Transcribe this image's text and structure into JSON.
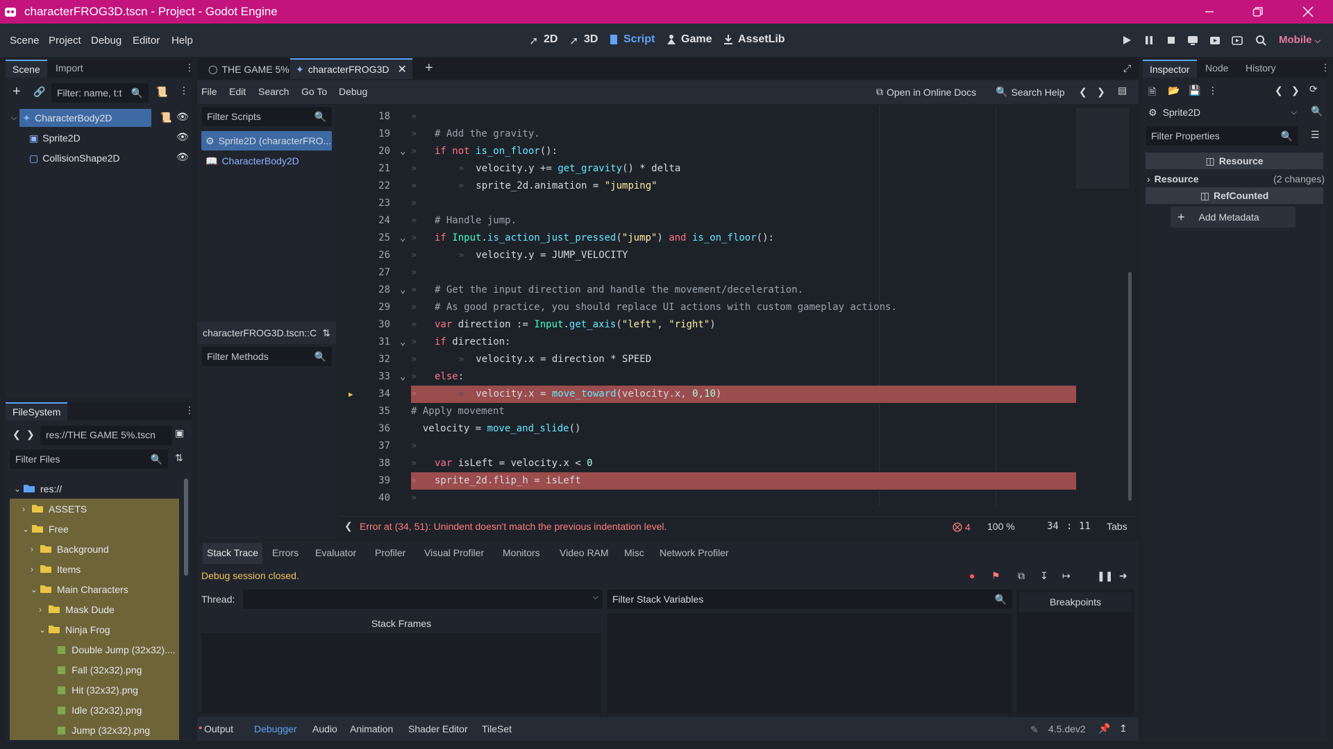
{
  "window": {
    "title": "characterFROG3D.tscn - Project - Godot Engine",
    "brand_color": "#c3147d"
  },
  "menu": [
    "Scene",
    "Project",
    "Debug",
    "Editor",
    "Help"
  ],
  "main_screens": [
    {
      "label": "2D",
      "icon": "2d-icon"
    },
    {
      "label": "3D",
      "icon": "3d-icon"
    },
    {
      "label": "Script",
      "icon": "script-icon",
      "active": true
    },
    {
      "label": "Game",
      "icon": "game-icon"
    },
    {
      "label": "AssetLib",
      "icon": "assetlib-icon"
    }
  ],
  "renderer": "Mobile",
  "scene_dock": {
    "tabs": [
      "Scene",
      "Import"
    ],
    "filter_placeholder": "Filter: name, t:t",
    "nodes": [
      {
        "label": "CharacterBody2D",
        "selected": true
      },
      {
        "label": "Sprite2D"
      },
      {
        "label": "CollisionShape2D"
      }
    ]
  },
  "filesystem": {
    "tab": "FileSystem",
    "path": "res://THE GAME 5%.tscn",
    "filter_placeholder": "Filter Files",
    "items": [
      {
        "label": "res://",
        "kind": "folder-open"
      },
      {
        "label": "ASSETS",
        "kind": "folder"
      },
      {
        "label": "Free",
        "kind": "folder-open"
      },
      {
        "label": "Background",
        "kind": "folder"
      },
      {
        "label": "Items",
        "kind": "folder"
      },
      {
        "label": "Main Characters",
        "kind": "folder-open"
      },
      {
        "label": "Mask Dude",
        "kind": "folder"
      },
      {
        "label": "Ninja Frog",
        "kind": "folder-open"
      },
      {
        "label": "Double Jump (32x32)....",
        "kind": "image"
      },
      {
        "label": "Fall (32x32).png",
        "kind": "image"
      },
      {
        "label": "Hit (32x32).png",
        "kind": "image"
      },
      {
        "label": "Idle (32x32).png",
        "kind": "image"
      },
      {
        "label": "Jump (32x32).png",
        "kind": "image"
      }
    ]
  },
  "scene_tabs": [
    "THE GAME 5%",
    "characterFROG3D"
  ],
  "script_menu": [
    "File",
    "Edit",
    "Search",
    "Go To",
    "Debug"
  ],
  "script_toolbar": {
    "docs": "Open in Online Docs",
    "help": "Search Help"
  },
  "script_list": {
    "filter_placeholder": "Filter Scripts",
    "items": [
      "Sprite2D (characterFRO...",
      "CharacterBody2D"
    ],
    "current": "characterFROG3D.tscn::C",
    "methods_placeholder": "Filter Methods"
  },
  "code": {
    "lines": [
      {
        "n": "18",
        "html": ""
      },
      {
        "n": "19",
        "html": "<span class='com'># Add the gravity.</span>"
      },
      {
        "n": "20",
        "html": "<span class='kw'>if not</span> <span class='fn'>is_on_floor</span>():"
      },
      {
        "n": "21",
        "html": "\t<span class='tabmark'>»</span> velocity.y += <span class='fn'>get_gravity</span>() * delta"
      },
      {
        "n": "22",
        "html": "\t<span class='tabmark'>»</span> sprite_2d.animation = <span class='str'>\"jumping\"</span>"
      },
      {
        "n": "23",
        "html": ""
      },
      {
        "n": "24",
        "html": "<span class='com'># Handle jump.</span>"
      },
      {
        "n": "25",
        "html": "<span class='kw'>if</span> <span class='cls'>Input</span>.<span class='fn'>is_action_just_pressed</span>(<span class='str'>\"jump\"</span>) <span class='kw'>and</span> <span class='fn'>is_on_floor</span>():"
      },
      {
        "n": "26",
        "html": "\t<span class='tabmark'>»</span> velocity.y = JUMP_VELOCITY"
      },
      {
        "n": "27",
        "html": ""
      },
      {
        "n": "28",
        "html": "<span class='com'># Get the input direction and handle the movement/deceleration.</span>"
      },
      {
        "n": "29",
        "html": "<span class='com'># As good practice, you should replace UI actions with custom gameplay actions.</span>"
      },
      {
        "n": "30",
        "html": "<span class='kw'>var</span> direction := <span class='cls'>Input</span>.<span class='fn'>get_axis</span>(<span class='str'>\"left\"</span>, <span class='str'>\"right\"</span>)"
      },
      {
        "n": "31",
        "html": "<span class='kw'>if</span> direction:"
      },
      {
        "n": "32",
        "html": "\t<span class='tabmark'>»</span> velocity.x = direction * SPEED"
      },
      {
        "n": "33",
        "html": "<span class='kw'>else</span>:"
      },
      {
        "n": "34",
        "html": "\t<span class='tabmark'>»</span> velocity.x = <span class='fn'>move_toward</span>(velocity.x, <span class='num'>0</span>,<span class='num'>10</span>)",
        "error": true,
        "exec": true
      },
      {
        "n": "35",
        "html": "<span class='com'># Apply movement</span>",
        "outdent": true
      },
      {
        "n": "36",
        "html": "  velocity = <span class='fn'>move_and_slide</span>()",
        "outdent": true
      },
      {
        "n": "37",
        "html": ""
      },
      {
        "n": "38",
        "html": "<span class='kw'>var</span> isLeft = velocity.x &lt; <span class='num'>0</span>"
      },
      {
        "n": "39",
        "html": "sprite_2d.flip_h = isLeft",
        "error": true
      },
      {
        "n": "40",
        "html": ""
      }
    ]
  },
  "status": {
    "error": "Error at (34, 51): Unindent doesn't match the previous indentation level.",
    "error_count": "4",
    "zoom": "100 %",
    "line": "34",
    "sep": ":",
    "col": "11",
    "indent": "Tabs"
  },
  "debugger": {
    "tabs": [
      "Stack Trace",
      "Errors",
      "Evaluator",
      "Profiler",
      "Visual Profiler",
      "Monitors",
      "Video RAM",
      "Misc",
      "Network Profiler"
    ],
    "session": "Debug session closed.",
    "thread_label": "Thread:",
    "stack_frames": "Stack Frames",
    "filter_vars": "Filter Stack Variables",
    "breakpoints": "Breakpoints"
  },
  "bottom_tabs": [
    "Output",
    "Debugger",
    "Audio",
    "Animation",
    "Shader Editor",
    "TileSet"
  ],
  "version": "4.5.dev2",
  "inspector": {
    "tabs": [
      "Inspector",
      "Node",
      "History"
    ],
    "object": "Sprite2D",
    "filter_placeholder": "Filter Properties",
    "section_resource": "Resource",
    "resource_label": "Resource",
    "resource_changes": "(2 changes)",
    "section_refcounted": "RefCounted",
    "add_metadata": "Add Metadata"
  }
}
